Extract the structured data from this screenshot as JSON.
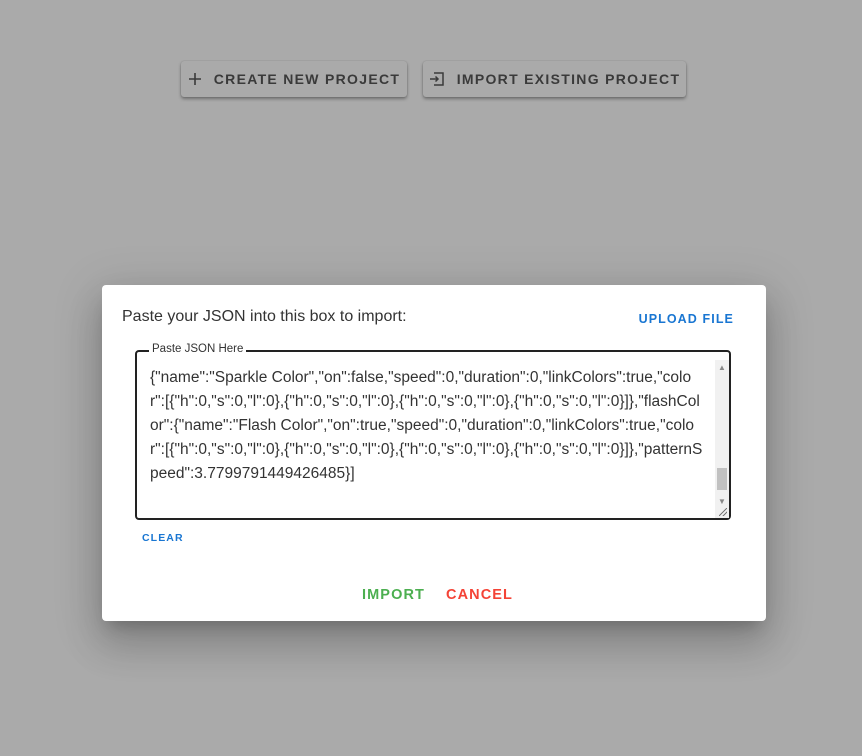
{
  "toolbar": {
    "create_label": "CREATE NEW PROJECT",
    "import_existing_label": "IMPORT EXISTING PROJECT"
  },
  "dialog": {
    "title": "Paste your JSON into this box to import:",
    "upload_label": "UPLOAD FILE",
    "field_label": "Paste JSON Here",
    "json_value": "{\"name\":\"Sparkle Color\",\"on\":false,\"speed\":0,\"duration\":0,\"linkColors\":true,\"color\":[{\"h\":0,\"s\":0,\"l\":0},{\"h\":0,\"s\":0,\"l\":0},{\"h\":0,\"s\":0,\"l\":0},{\"h\":0,\"s\":0,\"l\":0}]},\"flashColor\":{\"name\":\"Flash Color\",\"on\":true,\"speed\":0,\"duration\":0,\"linkColors\":true,\"color\":[{\"h\":0,\"s\":0,\"l\":0},{\"h\":0,\"s\":0,\"l\":0},{\"h\":0,\"s\":0,\"l\":0},{\"h\":0,\"s\":0,\"l\":0}]},\"patternSpeed\":3.7799791449426485}]",
    "clear_label": "CLEAR",
    "import_label": "IMPORT",
    "cancel_label": "CANCEL"
  },
  "colors": {
    "primary": "#1976d2",
    "success": "#4caf50",
    "danger": "#f44336",
    "backdrop": "#aaaaaa"
  },
  "icons": {
    "create": "plus-icon",
    "import_existing": "login-icon"
  }
}
